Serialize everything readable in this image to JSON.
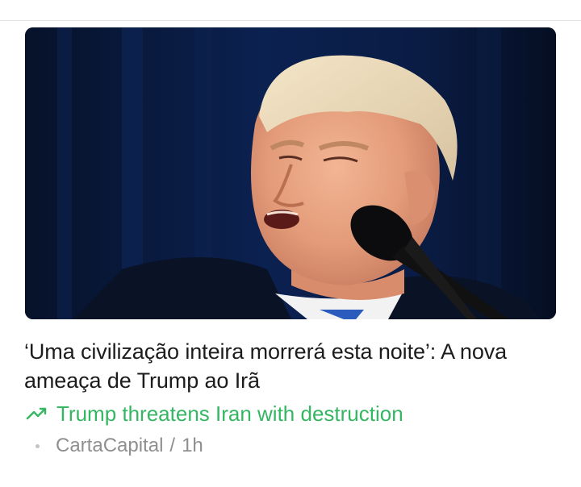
{
  "article": {
    "headline": "‘Uma civilização inteira morrerá esta noite’: A nova ameaça de Trump ao Irã",
    "trending": {
      "icon": "trending-up-icon",
      "text": "Trump threatens Iran with destruction",
      "color": "#34b663"
    },
    "source": "CartaCapital",
    "separator": "/",
    "age": "1h"
  }
}
